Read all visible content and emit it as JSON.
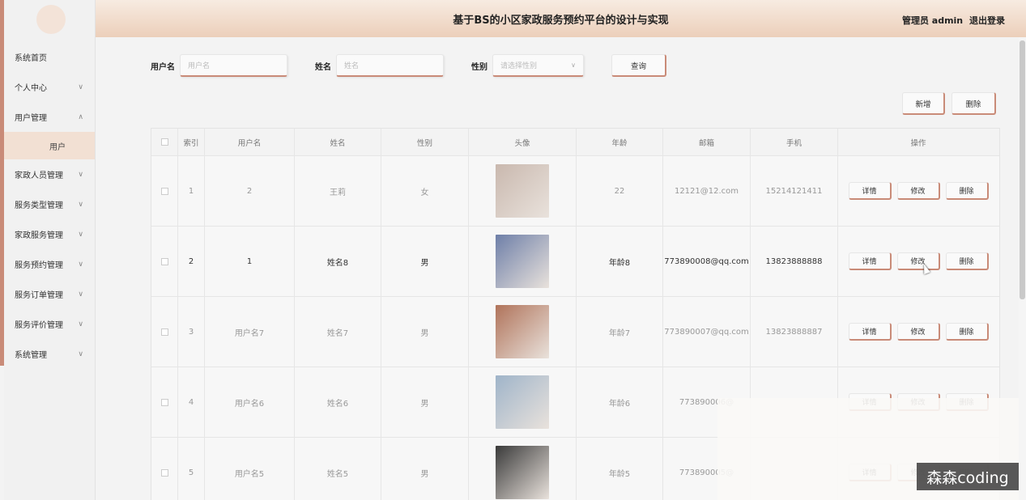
{
  "header": {
    "title": "基于BS的小区家政服务预约平台的设计与实现",
    "role": "管理员 admin",
    "logout": "退出登录"
  },
  "sidebar": {
    "items": [
      {
        "label": "系统首页",
        "chevron": ""
      },
      {
        "label": "个人中心",
        "chevron": "chevron-down-icon"
      },
      {
        "label": "用户管理",
        "chevron": "chevron-up-icon"
      },
      {
        "label": "用户",
        "sub": true
      },
      {
        "label": "家政人员管理",
        "chevron": "chevron-down-icon"
      },
      {
        "label": "服务类型管理",
        "chevron": "chevron-down-icon"
      },
      {
        "label": "家政服务管理",
        "chevron": "chevron-down-icon"
      },
      {
        "label": "服务预约管理",
        "chevron": "chevron-down-icon"
      },
      {
        "label": "服务订单管理",
        "chevron": "chevron-down-icon"
      },
      {
        "label": "服务评价管理",
        "chevron": "chevron-down-icon"
      },
      {
        "label": "系统管理",
        "chevron": "chevron-down-icon"
      }
    ]
  },
  "search": {
    "username_label": "用户名",
    "username_placeholder": "用户名",
    "name_label": "姓名",
    "name_placeholder": "姓名",
    "gender_label": "性别",
    "gender_placeholder": "请选择性别",
    "query_button": "查询"
  },
  "toolbar": {
    "add_button": "新增",
    "delete_button": "删除"
  },
  "table": {
    "columns": [
      "索引",
      "用户名",
      "姓名",
      "性别",
      "头像",
      "年龄",
      "邮箱",
      "手机",
      "操作"
    ],
    "rows": [
      {
        "index": "1",
        "username": "2",
        "name": "王莉",
        "gender": "女",
        "avatar_color": "#c9b8ae",
        "age": "22",
        "email": "12121@12.com",
        "phone": "15214121411"
      },
      {
        "index": "2",
        "username": "1",
        "name": "姓名8",
        "gender": "男",
        "avatar_color": "#6e7fa8",
        "age": "年龄8",
        "email": "773890008@qq.com",
        "phone": "13823888888"
      },
      {
        "index": "3",
        "username": "用户名7",
        "name": "姓名7",
        "gender": "男",
        "avatar_color": "#b0735a",
        "age": "年龄7",
        "email": "773890007@qq.com",
        "phone": "13823888887"
      },
      {
        "index": "4",
        "username": "用户名6",
        "name": "姓名6",
        "gender": "男",
        "avatar_color": "#9fb4c9",
        "age": "年龄6",
        "email": "773890006@",
        "phone": ""
      },
      {
        "index": "5",
        "username": "用户名5",
        "name": "姓名5",
        "gender": "男",
        "avatar_color": "#3a3a3a",
        "age": "年龄5",
        "email": "773890005@",
        "phone": ""
      }
    ],
    "row_actions": {
      "detail": "详情",
      "edit": "修改",
      "delete": "删除"
    }
  },
  "watermark": "森森coding",
  "colors": {
    "accent": "#c98b78",
    "header_start": "#f7ebe1",
    "header_end": "#eccfba"
  }
}
